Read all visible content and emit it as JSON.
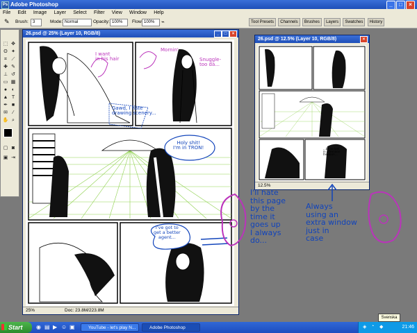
{
  "app": {
    "title": "Adobe Photoshop",
    "logo_text": "Ps",
    "window_controls": [
      "_",
      "□",
      "×"
    ]
  },
  "menu": [
    "File",
    "Edit",
    "Image",
    "Layer",
    "Select",
    "Filter",
    "View",
    "Window",
    "Help"
  ],
  "options_bar": {
    "brush_label": "Brush:",
    "brush_size": "3",
    "mode_label": "Mode:",
    "mode_value": "Normal",
    "opacity_label": "Opacity:",
    "opacity_value": "100%",
    "flow_label": "Flow:",
    "flow_value": "100%"
  },
  "palette_tabs": [
    "Tool Presets",
    "Channels",
    "Brushes",
    "Layers",
    "Swatches",
    "History"
  ],
  "windows": {
    "main": {
      "title": "26.psd @ 25% (Layer 10, RGB/8)",
      "zoom": "25%",
      "doc_info": "Doc: 23.8M/223.8M"
    },
    "secondary": {
      "title": "26.psd @ 12.5% (Layer 10, RGB/8)",
      "zoom": "12.5%"
    }
  },
  "comic_text": {
    "p1_note": "I want\nin his hair",
    "p1_morning": "Mornin'",
    "p1_snuggle": "Snuggle-\ntoo da...",
    "p1_gawd": "Gawd, I hate\ndrawing scenery...",
    "p2_tron": "Holy shit!\nI'm in TRON!",
    "p3_secret": "I've got to\nget a better\nagent...",
    "small_page_text": "...be so lost\nin afternoon\nfreedom..."
  },
  "annotations": {
    "left": "I'll hate\nthis page\nby the\ntime it\ngoes up\nI always\ndo...",
    "right": "Always\nusing an\nextra window\njust in\ncase"
  },
  "taskbar": {
    "start_label": "Start",
    "tasks": [
      "YouTube - let's play N...",
      "Adobe Photoshop"
    ],
    "clock": "21:46",
    "language": "Svenska"
  },
  "colors": {
    "titlebar": "#2458c8",
    "annotation_blue": "#1144bb",
    "annotation_purple": "#bb33bb",
    "grid_green": "#8fd14f"
  }
}
